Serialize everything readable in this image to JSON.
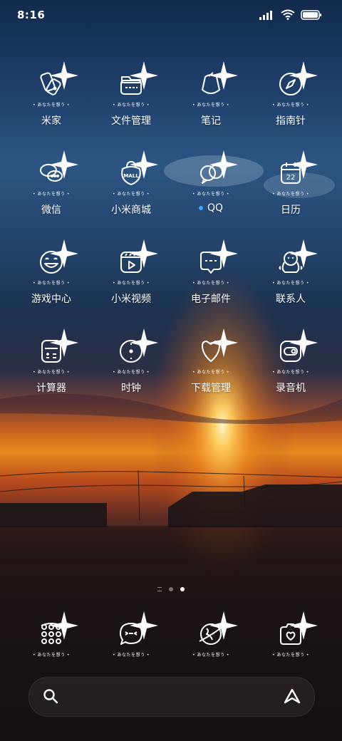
{
  "status_bar": {
    "time": "8:16"
  },
  "icon_caption": "あなたを想う",
  "apps": [
    {
      "label": "米家",
      "icon": "mi-home-icon"
    },
    {
      "label": "文件管理",
      "icon": "folder-icon"
    },
    {
      "label": "笔记",
      "icon": "notes-icon"
    },
    {
      "label": "指南针",
      "icon": "compass-icon"
    },
    {
      "label": "微信",
      "icon": "wechat-icon"
    },
    {
      "label": "小米商城",
      "icon": "mall-icon"
    },
    {
      "label": "QQ",
      "icon": "qq-icon",
      "new_badge": true
    },
    {
      "label": "日历",
      "icon": "calendar-icon",
      "day": "22"
    },
    {
      "label": "游戏中心",
      "icon": "game-smiley-icon"
    },
    {
      "label": "小米视频",
      "icon": "video-icon"
    },
    {
      "label": "电子邮件",
      "icon": "email-icon"
    },
    {
      "label": "联系人",
      "icon": "contacts-icon"
    },
    {
      "label": "计算器",
      "icon": "calculator-icon"
    },
    {
      "label": "时钟",
      "icon": "clock-icon"
    },
    {
      "label": "下载管理",
      "icon": "download-heart-icon"
    },
    {
      "label": "录音机",
      "icon": "recorder-icon"
    }
  ],
  "mall_icon_text": "MALL",
  "dock": [
    {
      "icon": "phone-dialpad-icon"
    },
    {
      "icon": "messages-icon"
    },
    {
      "icon": "browser-icon"
    },
    {
      "icon": "camera-icon"
    }
  ],
  "pager": {
    "pages": 3,
    "active": 2
  },
  "colors": {
    "accent_dot": "#3aa6ff"
  }
}
